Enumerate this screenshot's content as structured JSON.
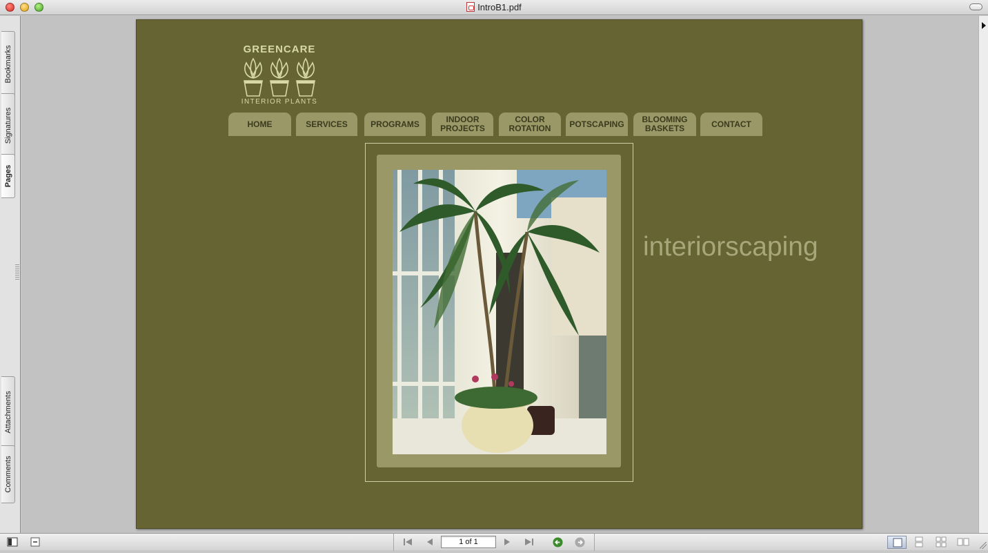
{
  "window": {
    "title": "IntroB1.pdf"
  },
  "sidebar": {
    "tabs": [
      {
        "label": "Bookmarks"
      },
      {
        "label": "Signatures"
      },
      {
        "label": "Pages"
      },
      {
        "label": "Attachments"
      },
      {
        "label": "Comments"
      }
    ]
  },
  "document": {
    "logo_top": "GREENCARE",
    "logo_bottom": "INTERIOR PLANTS",
    "nav": [
      {
        "label": "HOME"
      },
      {
        "label": "SERVICES"
      },
      {
        "label": "PROGRAMS"
      },
      {
        "label": "INDOOR\nPROJECTS"
      },
      {
        "label": "COLOR\nROTATION"
      },
      {
        "label": "POTSCAPING"
      },
      {
        "label": "BLOOMING\nBASKETS"
      },
      {
        "label": "CONTACT"
      }
    ],
    "tagline": "interiorscaping",
    "colors": {
      "page_bg": "#676433",
      "tab_bg": "#9a9866",
      "tab_text": "#3a3a1e",
      "tagline": "#a8a77a"
    }
  },
  "bottombar": {
    "page_field": "1 of 1",
    "icons": [
      "first-page-icon",
      "previous-page-icon",
      "next-page-icon",
      "last-page-icon",
      "go-back-icon",
      "go-forward-icon",
      "single-page-icon",
      "continuous-icon",
      "facing-icon",
      "facing-continuous-icon"
    ]
  }
}
